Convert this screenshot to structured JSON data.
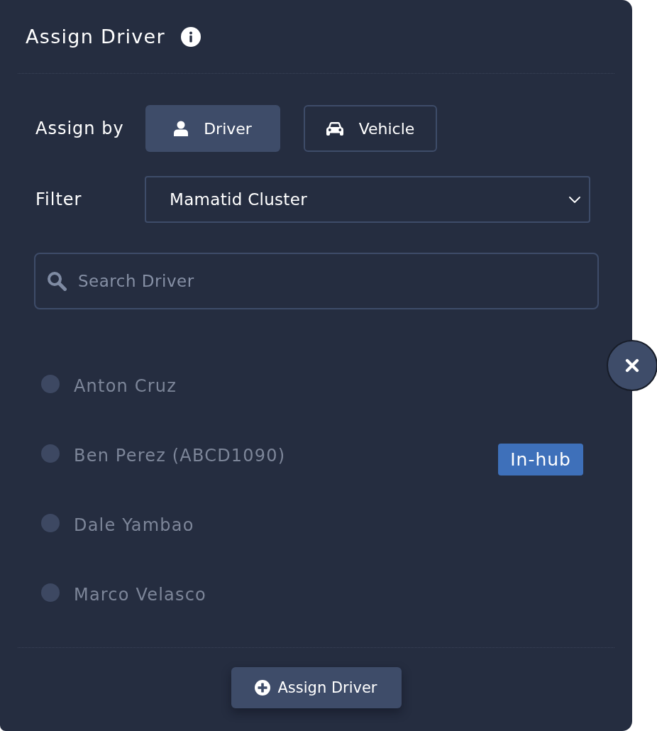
{
  "dialog": {
    "title": "Assign Driver"
  },
  "assign_by": {
    "label": "Assign by",
    "options": [
      {
        "label": "Driver",
        "kind": "person",
        "selected": true
      },
      {
        "label": "Vehicle",
        "kind": "car",
        "selected": false
      }
    ]
  },
  "filter": {
    "label": "Filter",
    "value": "Mamatid Cluster"
  },
  "search": {
    "placeholder": "Search Driver"
  },
  "drivers": [
    {
      "name": "Anton Cruz",
      "selected": false
    },
    {
      "name": "Ben Perez (ABCD1090)",
      "selected": false,
      "badge": "In-hub"
    },
    {
      "name": "Dale Yambao",
      "selected": false
    },
    {
      "name": "Marco Velasco",
      "selected": false
    }
  ],
  "footer": {
    "button": "Assign Driver"
  }
}
